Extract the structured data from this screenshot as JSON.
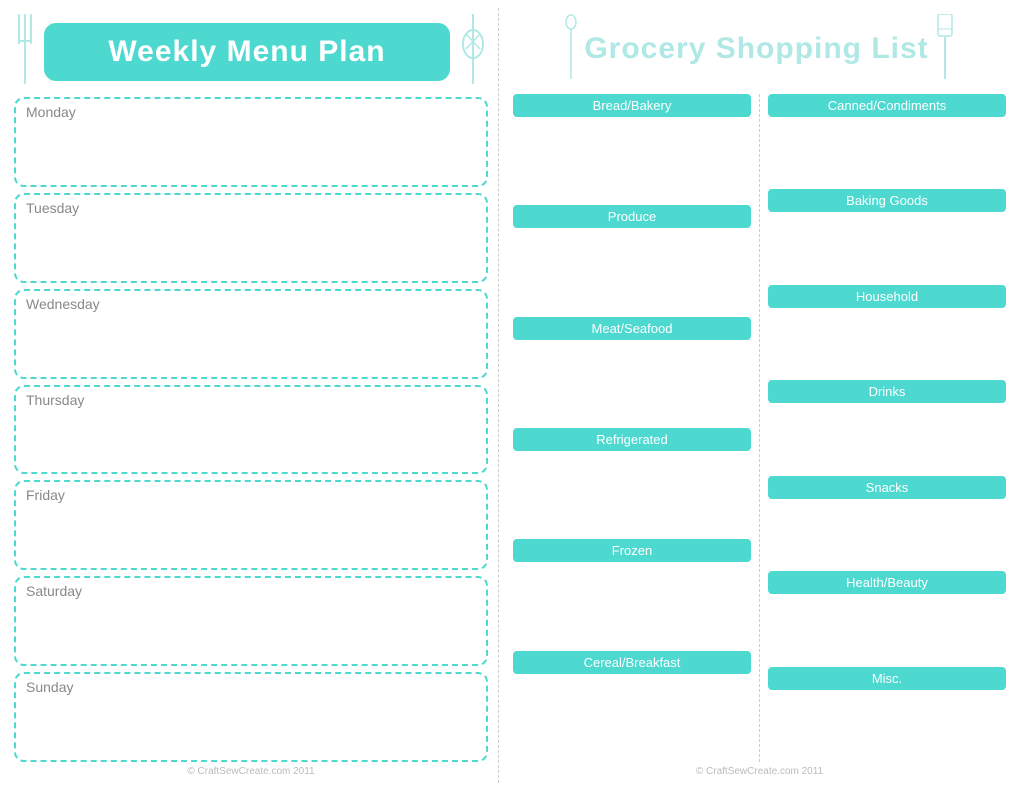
{
  "left": {
    "title": "Weekly Menu Plan",
    "days": [
      {
        "label": "Monday"
      },
      {
        "label": "Tuesday"
      },
      {
        "label": "Wednesday"
      },
      {
        "label": "Thursday"
      },
      {
        "label": "Friday"
      },
      {
        "label": "Saturday"
      },
      {
        "label": "Sunday"
      }
    ],
    "copyright": "© CraftSewCreate.com 2011"
  },
  "right": {
    "title": "Grocery Shopping List",
    "copyright": "© CraftSewCreate.com 2011",
    "col1_sections": [
      {
        "label": "Bread/Bakery"
      },
      {
        "label": "Produce"
      },
      {
        "label": "Meat/Seafood"
      },
      {
        "label": "Refrigerated"
      },
      {
        "label": "Frozen"
      },
      {
        "label": "Cereal/Breakfast"
      }
    ],
    "col2_sections": [
      {
        "label": "Canned/Condiments"
      },
      {
        "label": "Baking Goods"
      },
      {
        "label": "Household"
      },
      {
        "label": "Drinks"
      },
      {
        "label": "Snacks"
      },
      {
        "label": "Health/Beauty"
      },
      {
        "label": "Misc."
      }
    ]
  },
  "icons": {
    "fork": "fork",
    "whisk": "whisk",
    "spatula": "spatula"
  },
  "accent_color": "#4dd9d0",
  "light_accent": "#b0e8e5"
}
